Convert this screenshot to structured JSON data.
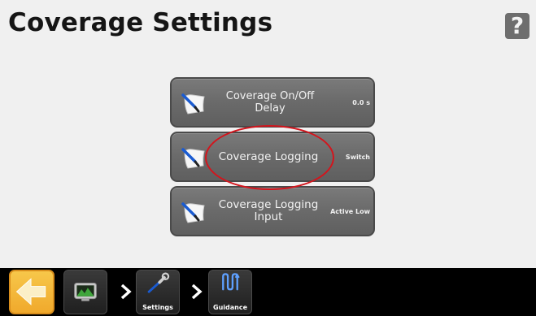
{
  "header": {
    "title": "Coverage Settings",
    "help_label": "?"
  },
  "settings": [
    {
      "label": "Coverage On/Off Delay",
      "value": "0.0 s"
    },
    {
      "label": "Coverage Logging",
      "value": "Switch"
    },
    {
      "label": "Coverage Logging Input",
      "value": "Active Low"
    }
  ],
  "nav": {
    "back_icon": "arrow-left-icon",
    "home_icon": "monitor-icon",
    "settings_label": "Settings",
    "guidance_label": "Guidance"
  },
  "colors": {
    "accent": "#f0a92c",
    "highlight": "#d4141c",
    "button": "#6a6a6a",
    "nav_background": "#000000"
  }
}
